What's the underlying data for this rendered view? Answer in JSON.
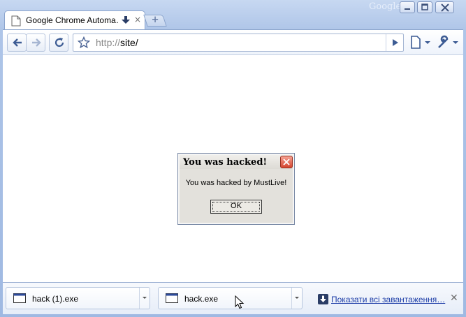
{
  "window": {
    "brand_label": "Google"
  },
  "tab": {
    "title": "Google Chrome Automa…",
    "close_glyph": "×",
    "new_tab_glyph": "+"
  },
  "toolbar": {
    "url_scheme": "http://",
    "url_rest": "site/"
  },
  "dialog": {
    "title": "You was hacked!",
    "message": "You was hacked by MustLive!",
    "ok_label": "OK"
  },
  "downloads": {
    "items": [
      {
        "filename": "hack (1).exe"
      },
      {
        "filename": "hack.exe"
      }
    ],
    "show_all_label": "Показати всі завантаження…",
    "close_glyph": "✕"
  },
  "colors": {
    "frame": "#aec5e8",
    "link": "#1f3fa8",
    "dialog_close": "#d4452f"
  }
}
